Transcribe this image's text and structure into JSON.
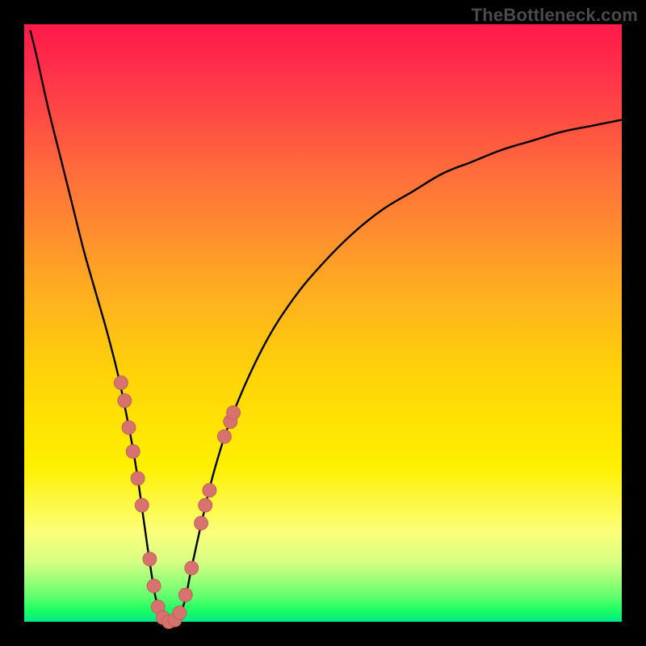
{
  "watermark": "TheBottleneck.com",
  "colors": {
    "curve_stroke": "#000000",
    "marker_fill": "#d7726f",
    "marker_stroke": "#b95a57",
    "frame": "#000000"
  },
  "chart_data": {
    "type": "line",
    "title": "",
    "xlabel": "",
    "ylabel": "",
    "xlim": [
      0,
      100
    ],
    "ylim": [
      0,
      100
    ],
    "grid": false,
    "legend": false,
    "series": [
      {
        "name": "curve",
        "x": [
          1,
          2,
          4,
          6,
          8,
          10,
          12,
          14,
          16,
          18,
          19,
          20,
          21,
          22,
          23,
          24,
          25,
          26,
          27,
          28,
          30,
          32,
          35,
          40,
          45,
          50,
          55,
          60,
          65,
          70,
          75,
          80,
          85,
          90,
          95,
          100
        ],
        "y": [
          99,
          95,
          86,
          78,
          70,
          62,
          55,
          48,
          40,
          30,
          24,
          17,
          10,
          4,
          1,
          0,
          0,
          1,
          4,
          9,
          18,
          26,
          35,
          46,
          54,
          60,
          65,
          69,
          72,
          75,
          77,
          79,
          80.5,
          82,
          83,
          84
        ]
      }
    ],
    "markers": [
      {
        "x": 16.2,
        "y": 40.0
      },
      {
        "x": 16.8,
        "y": 37.0
      },
      {
        "x": 17.5,
        "y": 32.5
      },
      {
        "x": 18.2,
        "y": 28.5
      },
      {
        "x": 19.0,
        "y": 24.0
      },
      {
        "x": 19.7,
        "y": 19.5
      },
      {
        "x": 21.0,
        "y": 10.5
      },
      {
        "x": 21.7,
        "y": 6.0
      },
      {
        "x": 22.4,
        "y": 2.5
      },
      {
        "x": 23.2,
        "y": 0.7
      },
      {
        "x": 24.2,
        "y": 0.0
      },
      {
        "x": 25.2,
        "y": 0.3
      },
      {
        "x": 26.0,
        "y": 1.5
      },
      {
        "x": 27.0,
        "y": 4.5
      },
      {
        "x": 28.0,
        "y": 9.0
      },
      {
        "x": 29.6,
        "y": 16.5
      },
      {
        "x": 30.3,
        "y": 19.5
      },
      {
        "x": 31.0,
        "y": 22.0
      },
      {
        "x": 33.5,
        "y": 31.0
      },
      {
        "x": 34.5,
        "y": 33.5
      },
      {
        "x": 35.0,
        "y": 35.0
      }
    ]
  }
}
